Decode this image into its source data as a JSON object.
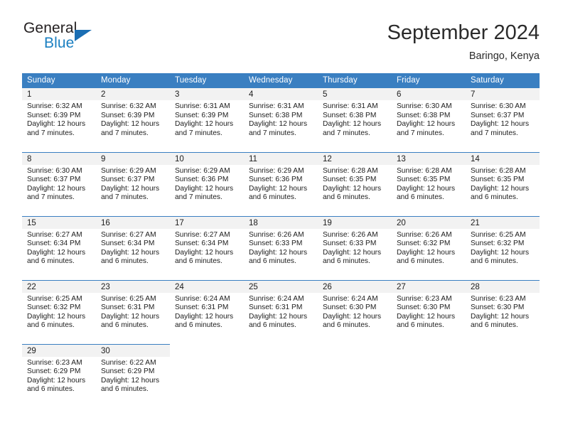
{
  "brand": {
    "name_part1": "General",
    "name_part2": "Blue",
    "logo_icon": "triangle-flag-icon"
  },
  "header": {
    "title": "September 2024",
    "subtitle": "Baringo, Kenya"
  },
  "weekday_headers": [
    "Sunday",
    "Monday",
    "Tuesday",
    "Wednesday",
    "Thursday",
    "Friday",
    "Saturday"
  ],
  "colors": {
    "header_blue": "#3a7fc1",
    "band_gray": "#f2f2f2",
    "brand_blue": "#1a7fc1",
    "text": "#1c1c1c"
  },
  "labels": {
    "sunrise_prefix": "Sunrise:",
    "sunset_prefix": "Sunset:",
    "daylight_prefix": "Daylight:"
  },
  "weeks": [
    [
      {
        "day": "1",
        "sunrise": "Sunrise: 6:32 AM",
        "sunset": "Sunset: 6:39 PM",
        "daylight": "Daylight: 12 hours and 7 minutes."
      },
      {
        "day": "2",
        "sunrise": "Sunrise: 6:32 AM",
        "sunset": "Sunset: 6:39 PM",
        "daylight": "Daylight: 12 hours and 7 minutes."
      },
      {
        "day": "3",
        "sunrise": "Sunrise: 6:31 AM",
        "sunset": "Sunset: 6:39 PM",
        "daylight": "Daylight: 12 hours and 7 minutes."
      },
      {
        "day": "4",
        "sunrise": "Sunrise: 6:31 AM",
        "sunset": "Sunset: 6:38 PM",
        "daylight": "Daylight: 12 hours and 7 minutes."
      },
      {
        "day": "5",
        "sunrise": "Sunrise: 6:31 AM",
        "sunset": "Sunset: 6:38 PM",
        "daylight": "Daylight: 12 hours and 7 minutes."
      },
      {
        "day": "6",
        "sunrise": "Sunrise: 6:30 AM",
        "sunset": "Sunset: 6:38 PM",
        "daylight": "Daylight: 12 hours and 7 minutes."
      },
      {
        "day": "7",
        "sunrise": "Sunrise: 6:30 AM",
        "sunset": "Sunset: 6:37 PM",
        "daylight": "Daylight: 12 hours and 7 minutes."
      }
    ],
    [
      {
        "day": "8",
        "sunrise": "Sunrise: 6:30 AM",
        "sunset": "Sunset: 6:37 PM",
        "daylight": "Daylight: 12 hours and 7 minutes."
      },
      {
        "day": "9",
        "sunrise": "Sunrise: 6:29 AM",
        "sunset": "Sunset: 6:37 PM",
        "daylight": "Daylight: 12 hours and 7 minutes."
      },
      {
        "day": "10",
        "sunrise": "Sunrise: 6:29 AM",
        "sunset": "Sunset: 6:36 PM",
        "daylight": "Daylight: 12 hours and 7 minutes."
      },
      {
        "day": "11",
        "sunrise": "Sunrise: 6:29 AM",
        "sunset": "Sunset: 6:36 PM",
        "daylight": "Daylight: 12 hours and 6 minutes."
      },
      {
        "day": "12",
        "sunrise": "Sunrise: 6:28 AM",
        "sunset": "Sunset: 6:35 PM",
        "daylight": "Daylight: 12 hours and 6 minutes."
      },
      {
        "day": "13",
        "sunrise": "Sunrise: 6:28 AM",
        "sunset": "Sunset: 6:35 PM",
        "daylight": "Daylight: 12 hours and 6 minutes."
      },
      {
        "day": "14",
        "sunrise": "Sunrise: 6:28 AM",
        "sunset": "Sunset: 6:35 PM",
        "daylight": "Daylight: 12 hours and 6 minutes."
      }
    ],
    [
      {
        "day": "15",
        "sunrise": "Sunrise: 6:27 AM",
        "sunset": "Sunset: 6:34 PM",
        "daylight": "Daylight: 12 hours and 6 minutes."
      },
      {
        "day": "16",
        "sunrise": "Sunrise: 6:27 AM",
        "sunset": "Sunset: 6:34 PM",
        "daylight": "Daylight: 12 hours and 6 minutes."
      },
      {
        "day": "17",
        "sunrise": "Sunrise: 6:27 AM",
        "sunset": "Sunset: 6:34 PM",
        "daylight": "Daylight: 12 hours and 6 minutes."
      },
      {
        "day": "18",
        "sunrise": "Sunrise: 6:26 AM",
        "sunset": "Sunset: 6:33 PM",
        "daylight": "Daylight: 12 hours and 6 minutes."
      },
      {
        "day": "19",
        "sunrise": "Sunrise: 6:26 AM",
        "sunset": "Sunset: 6:33 PM",
        "daylight": "Daylight: 12 hours and 6 minutes."
      },
      {
        "day": "20",
        "sunrise": "Sunrise: 6:26 AM",
        "sunset": "Sunset: 6:32 PM",
        "daylight": "Daylight: 12 hours and 6 minutes."
      },
      {
        "day": "21",
        "sunrise": "Sunrise: 6:25 AM",
        "sunset": "Sunset: 6:32 PM",
        "daylight": "Daylight: 12 hours and 6 minutes."
      }
    ],
    [
      {
        "day": "22",
        "sunrise": "Sunrise: 6:25 AM",
        "sunset": "Sunset: 6:32 PM",
        "daylight": "Daylight: 12 hours and 6 minutes."
      },
      {
        "day": "23",
        "sunrise": "Sunrise: 6:25 AM",
        "sunset": "Sunset: 6:31 PM",
        "daylight": "Daylight: 12 hours and 6 minutes."
      },
      {
        "day": "24",
        "sunrise": "Sunrise: 6:24 AM",
        "sunset": "Sunset: 6:31 PM",
        "daylight": "Daylight: 12 hours and 6 minutes."
      },
      {
        "day": "25",
        "sunrise": "Sunrise: 6:24 AM",
        "sunset": "Sunset: 6:31 PM",
        "daylight": "Daylight: 12 hours and 6 minutes."
      },
      {
        "day": "26",
        "sunrise": "Sunrise: 6:24 AM",
        "sunset": "Sunset: 6:30 PM",
        "daylight": "Daylight: 12 hours and 6 minutes."
      },
      {
        "day": "27",
        "sunrise": "Sunrise: 6:23 AM",
        "sunset": "Sunset: 6:30 PM",
        "daylight": "Daylight: 12 hours and 6 minutes."
      },
      {
        "day": "28",
        "sunrise": "Sunrise: 6:23 AM",
        "sunset": "Sunset: 6:30 PM",
        "daylight": "Daylight: 12 hours and 6 minutes."
      }
    ],
    [
      {
        "day": "29",
        "sunrise": "Sunrise: 6:23 AM",
        "sunset": "Sunset: 6:29 PM",
        "daylight": "Daylight: 12 hours and 6 minutes."
      },
      {
        "day": "30",
        "sunrise": "Sunrise: 6:22 AM",
        "sunset": "Sunset: 6:29 PM",
        "daylight": "Daylight: 12 hours and 6 minutes."
      },
      null,
      null,
      null,
      null,
      null
    ]
  ]
}
